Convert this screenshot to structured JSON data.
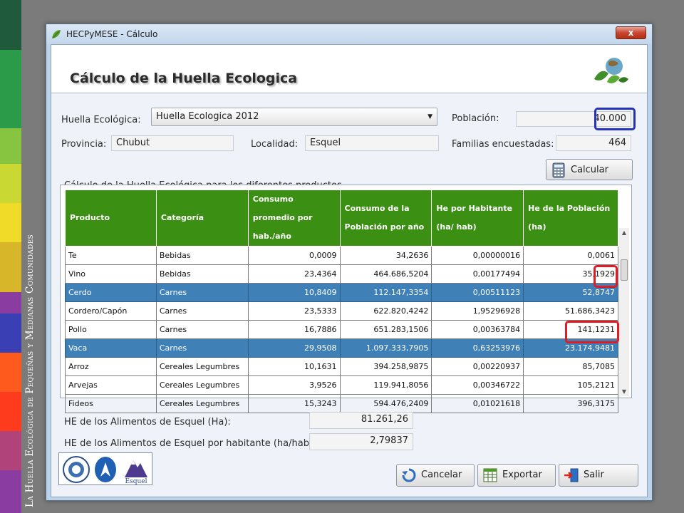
{
  "side_title": "La Huella Ecológica de Pequeñas y Medianas Comunidades",
  "side_colors": [
    "#1e5a3b",
    "#2b9b4a",
    "#87c540",
    "#c9d832",
    "#f0dc28",
    "#d7b62a",
    "#8a3ca0",
    "#3b3fb4",
    "#ff5a1e",
    "#ff3b1e",
    "#b0447a",
    "#8a3ca0"
  ],
  "window": {
    "title": "HECPyMESE - Cálculo",
    "close_label": "x"
  },
  "header": {
    "title": "Cálculo de la Huella Ecologica"
  },
  "form": {
    "huella_label": "Huella Ecológica:",
    "huella_value": "Huella Ecologica 2012",
    "poblacion_label": "Población:",
    "poblacion_value": "40.000",
    "provincia_label": "Provincia:",
    "provincia_value": "Chubut",
    "localidad_label": "Localidad:",
    "localidad_value": "Esquel",
    "familias_label": "Familias encuestadas:",
    "familias_value": "464",
    "calcular_label": "Calcular"
  },
  "table": {
    "caption": "Cálculo de la Huella Ecológica para los diferentes productos.",
    "headers": [
      "Producto",
      "Categoría",
      "Consumo promedio por hab./año",
      "Consumo de la Población por año",
      "He por Habitante (ha/ hab)",
      "He de la Población (ha)"
    ],
    "rows": [
      {
        "producto": "Te",
        "categoria": "Bebidas",
        "consumo": "0,0009",
        "consumo_pob": "34,2636",
        "he_hab": "0,00000016",
        "he_pob": "0,0061",
        "selected": false
      },
      {
        "producto": "Vino",
        "categoria": "Bebidas",
        "consumo": "23,4364",
        "consumo_pob": "464.686,5204",
        "he_hab": "0,00177494",
        "he_pob": "35,1929",
        "selected": false
      },
      {
        "producto": "Cerdo",
        "categoria": "Carnes",
        "consumo": "10,8409",
        "consumo_pob": "112.147,3354",
        "he_hab": "0,00511123",
        "he_pob": "52,8747",
        "selected": true
      },
      {
        "producto": "Cordero/Capón",
        "categoria": "Carnes",
        "consumo": "23,5333",
        "consumo_pob": "622.820,4242",
        "he_hab": "1,95296928",
        "he_pob": "51.686,3423",
        "selected": false
      },
      {
        "producto": "Pollo",
        "categoria": "Carnes",
        "consumo": "16,7886",
        "consumo_pob": "651.283,1506",
        "he_hab": "0,00363784",
        "he_pob": "141,1231",
        "selected": false
      },
      {
        "producto": "Vaca",
        "categoria": "Carnes",
        "consumo": "29,9508",
        "consumo_pob": "1.097.333,7905",
        "he_hab": "0,63253976",
        "he_pob": "23.174,9481",
        "selected": true
      },
      {
        "producto": "Arroz",
        "categoria": "Cereales Legumbres",
        "consumo": "10,1631",
        "consumo_pob": "394.258,9875",
        "he_hab": "0,00220937",
        "he_pob": "85,7085",
        "selected": false
      },
      {
        "producto": "Arvejas",
        "categoria": "Cereales Legumbres",
        "consumo": "3,9526",
        "consumo_pob": "119.941,8056",
        "he_hab": "0,00346722",
        "he_pob": "105,2121",
        "selected": false
      },
      {
        "producto": "Fideos",
        "categoria": "Cereales Legumbres",
        "consumo": "15,3243",
        "consumo_pob": "594.476,2409",
        "he_hab": "0,01021618",
        "he_pob": "396,3175",
        "selected": false
      }
    ]
  },
  "totals": {
    "he_label": "HE de los Alimentos de Esquel (Ha):",
    "he_value": "81.261,26",
    "he_hab_label": "HE de los Alimentos de Esquel por habitante (ha/hab):",
    "he_hab_value": "2,79837"
  },
  "logos": {
    "esquel_text": "Esquel"
  },
  "buttons": {
    "cancelar": "Cancelar",
    "exportar": "Exportar",
    "salir": "Salir"
  },
  "colors": {
    "grid_header": "#3b8f12",
    "selected_row": "#3f80b7",
    "blue_highlight": "#2533b8",
    "red_highlight": "#e01b24"
  }
}
